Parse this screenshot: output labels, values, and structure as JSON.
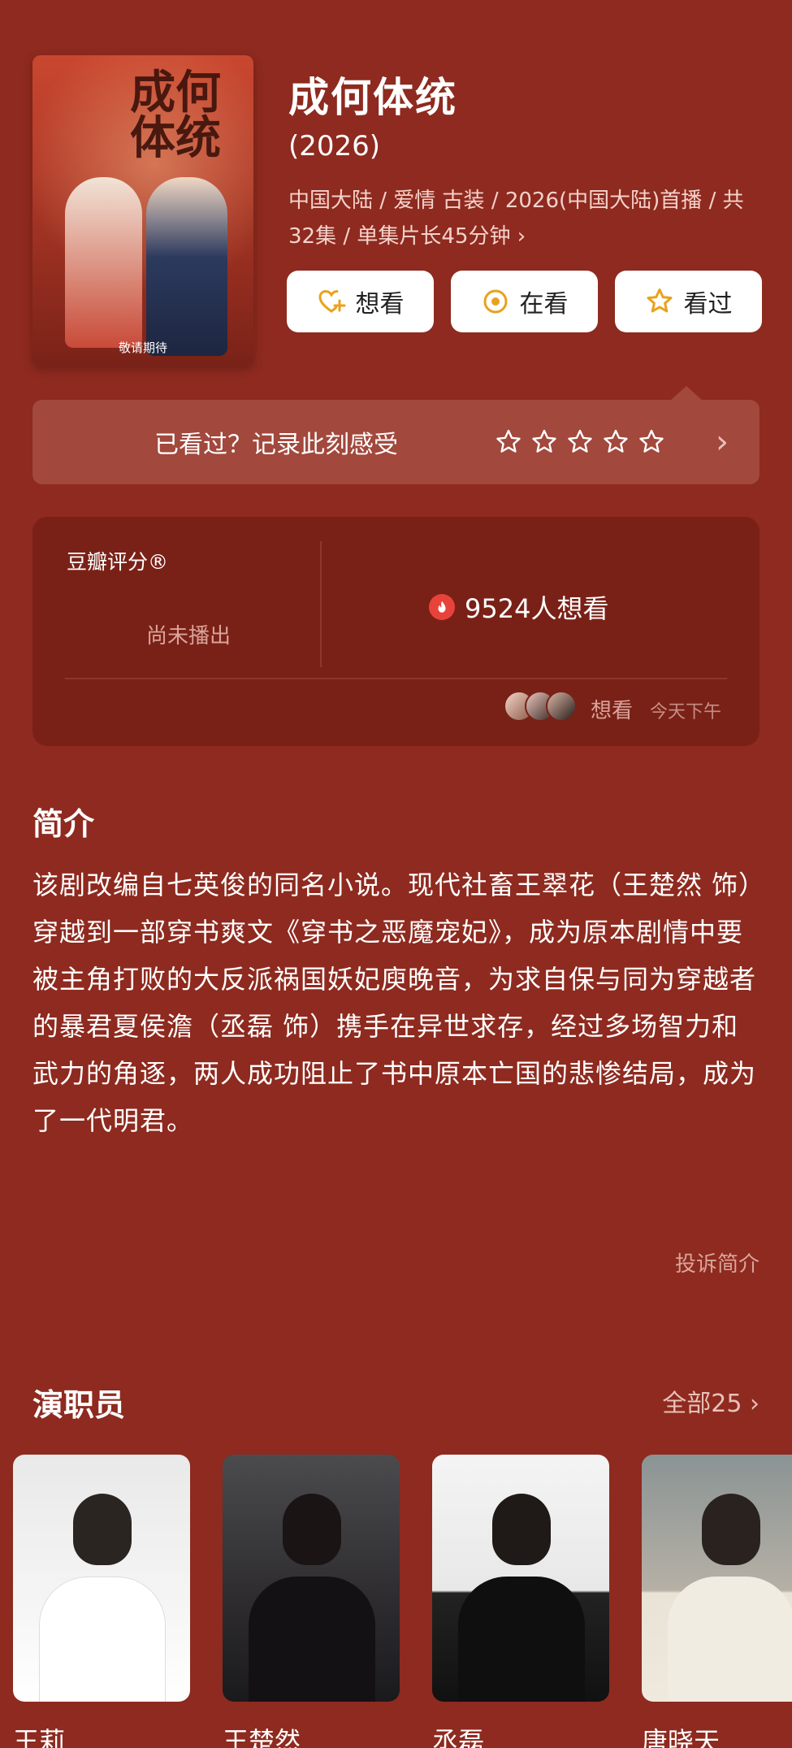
{
  "header": {
    "poster_caption": "敬请期待",
    "poster_calligraphy": "成何体统",
    "title": "成何体统",
    "year": "(2026)",
    "meta": "中国大陆 / 爱情 古装 / 2026(中国大陆)首播 / 共32集 / 单集片长45分钟",
    "meta_chevron": "›"
  },
  "actions": [
    {
      "label": "想看",
      "icon": "heart-plus-icon"
    },
    {
      "label": "在看",
      "icon": "target-circle-icon"
    },
    {
      "label": "看过",
      "icon": "star-outline-icon"
    }
  ],
  "rate_bar": {
    "text": "已看过？记录此刻感受",
    "star_count": 5,
    "chevron": "›"
  },
  "rating": {
    "label": "豆瓣评分®",
    "status": "尚未播出",
    "wish_text": "9524人想看",
    "activity_action": "想看",
    "activity_time": "今天下午"
  },
  "synopsis": {
    "title": "简介",
    "text": "该剧改编自七英俊的同名小说。现代社畜王翠花（王楚然 饰）穿越到一部穿书爽文《穿书之恶魔宠妃》，成为原本剧情中要被主角打败的大反派祸国妖妃庾晚音，为求自保与同为穿越者的暴君夏侯澹（丞磊 饰）携手在异世求存，经过多场智力和武力的角逐，两人成功阻止了书中原本亡国的悲惨结局，成为了一代明君。",
    "report_link": "投诉简介"
  },
  "cast": {
    "title": "演职员",
    "all_link": "全部25 ›",
    "members": [
      {
        "name": "王莉"
      },
      {
        "name": "王楚然"
      },
      {
        "name": "丞磊"
      },
      {
        "name": "唐晓天"
      }
    ]
  },
  "colors": {
    "background": "#8e2a1f",
    "card": "#7a2117",
    "rate_bar": "#a2483c",
    "accent_gold": "#e8a21c",
    "fire": "#e8433b"
  }
}
